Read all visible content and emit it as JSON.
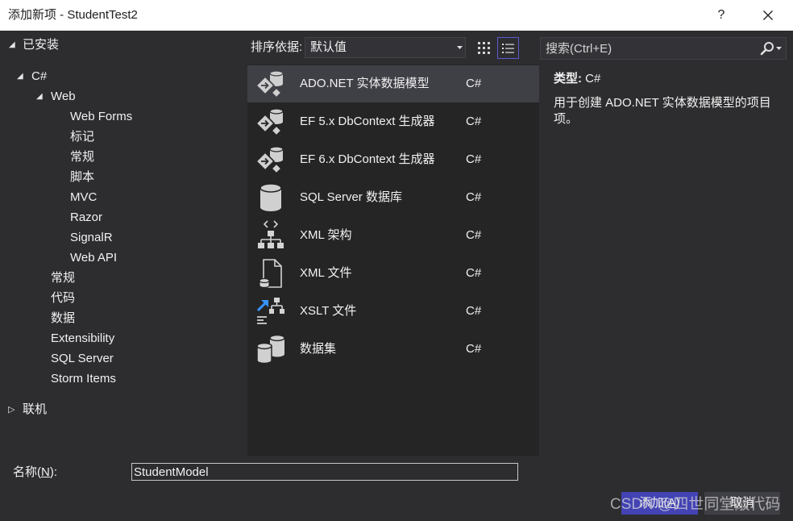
{
  "window": {
    "title": "添加新项 - StudentTest2",
    "help_label": "?"
  },
  "toolbar": {
    "sort_label": "排序依据:",
    "sort_value": "默认值",
    "selected_view": "list-view-icon",
    "search_placeholder": "搜索(Ctrl+E)"
  },
  "tree": {
    "installed_label": "已安装",
    "csharp_label": "C#",
    "web_label": "Web",
    "web_items": [
      "Web Forms",
      "标记",
      "常规",
      "脚本",
      "MVC",
      "Razor",
      "SignalR",
      "Web API"
    ],
    "csharp_items": [
      "常规",
      "代码",
      "数据",
      "Extensibility",
      "SQL Server",
      "Storm Items"
    ],
    "online_label": "联机"
  },
  "templates": [
    {
      "name": "ADO.NET 实体数据模型",
      "language": "C#",
      "icon": "entity-model-icon",
      "selected": true
    },
    {
      "name": "EF 5.x DbContext 生成器",
      "language": "C#",
      "icon": "dbcontext-generator-icon"
    },
    {
      "name": "EF 6.x DbContext 生成器",
      "language": "C#",
      "icon": "dbcontext-generator-icon"
    },
    {
      "name": "SQL Server 数据库",
      "language": "C#",
      "icon": "sql-database-icon"
    },
    {
      "name": "XML 架构",
      "language": "C#",
      "icon": "xml-schema-icon"
    },
    {
      "name": "XML 文件",
      "language": "C#",
      "icon": "xml-file-icon"
    },
    {
      "name": "XSLT 文件",
      "language": "C#",
      "icon": "xslt-file-icon"
    },
    {
      "name": "数据集",
      "language": "C#",
      "icon": "dataset-icon"
    }
  ],
  "details": {
    "type_label": "类型:",
    "type_value": "C#",
    "description": "用于创建 ADO.NET 实体数据模型的项目项。"
  },
  "name_field": {
    "label_before": "名称(",
    "label_mnemonic": "N",
    "label_after": "):",
    "value": "StudentModel"
  },
  "buttons": {
    "add_before": "添加(",
    "add_mnemonic": "A",
    "add_after": ")",
    "cancel": "取消"
  },
  "watermark": "CSDN @四世同堂敲代码",
  "colors": {
    "dialog_background": "#2d2d30",
    "list_background": "#252526",
    "selection": "#3f3f46",
    "primary_button": "#4343b5",
    "title_bar": "#ffffff",
    "xslt_arrow": "#3794ff"
  }
}
